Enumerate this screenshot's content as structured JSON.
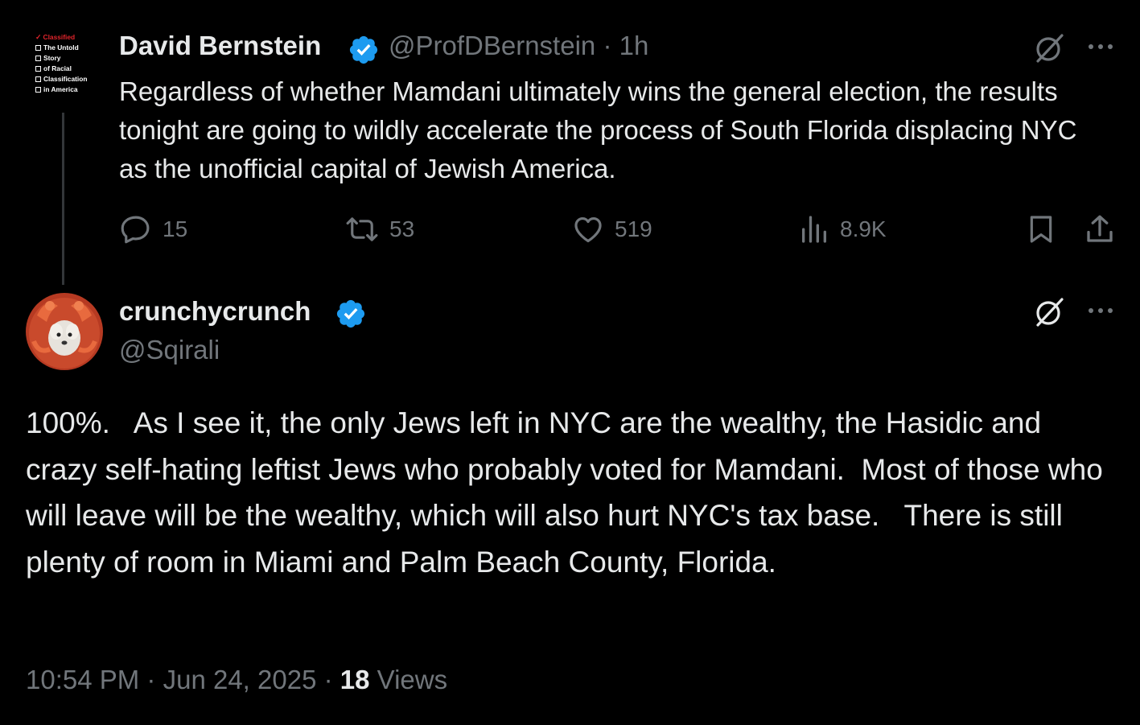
{
  "parent_tweet": {
    "avatar_text": {
      "classified": "Classified",
      "lines": [
        "The Untold",
        "Story",
        "of Racial",
        "Classification",
        "in America"
      ]
    },
    "display_name": "David Bernstein",
    "handle": "@ProfDBernstein",
    "separator": "·",
    "time_ago": "1h",
    "text": "Regardless of whether Mamdani ultimately wins the general election, the results tonight are going to wildly accelerate the process of South Florida displacing NYC as the unofficial capital of Jewish America.",
    "replies": "15",
    "reposts": "53",
    "likes": "519",
    "views": "8.9K",
    "icons": {
      "reply": "reply-icon",
      "repost": "repost-icon",
      "like": "heart-icon",
      "views": "views-chart-icon",
      "bookmark": "bookmark-icon",
      "share": "share-icon",
      "grok": "grok-icon",
      "more": "more-icon",
      "verified": "verified-badge-icon"
    }
  },
  "reply_tweet": {
    "display_name": "crunchycrunch",
    "handle": "@Sqirali",
    "text": "100%.   As I see it, the only Jews left in NYC are the wealthy, the Hasidic and crazy self-hating leftist Jews who probably voted for Mamdani.  Most of those who will leave will be the wealthy, which will also hurt NYC's tax base.   There is still plenty of room in Miami and Palm Beach County, Florida.",
    "time": "10:54 PM",
    "separator": "·",
    "date": "Jun 24, 2025",
    "views_count": "18",
    "views_label": "Views"
  },
  "colors": {
    "background": "#000000",
    "text": "#e7e9ea",
    "muted": "#71767b",
    "verified": "#1d9bf0",
    "thread_line": "#333639"
  }
}
